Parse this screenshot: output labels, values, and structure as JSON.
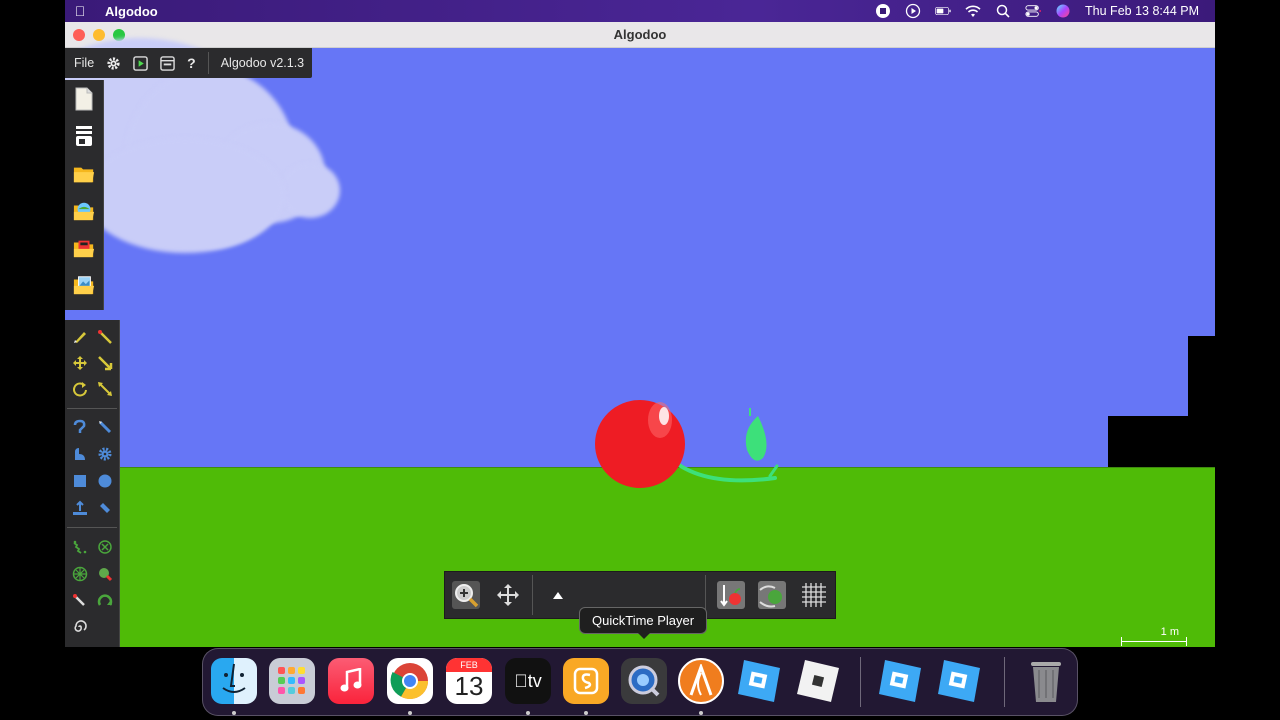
{
  "menubar": {
    "app_name": "Algodoo",
    "datetime": "Thu Feb 13  8:44 PM"
  },
  "window": {
    "title": "Algodoo"
  },
  "top_toolbar": {
    "file_label": "File",
    "version_label": "Algodoo v2.1.3"
  },
  "tooltip": {
    "text": "QuickTime Player"
  },
  "scale_bar": {
    "label": "1 m"
  },
  "dock": {
    "calendar_month": "FEB",
    "calendar_day": "13",
    "tv_label": "tv"
  },
  "colors": {
    "sky": "#6676f6",
    "ground": "#4fbb07",
    "cherry": "#ee1c24",
    "stem": "#3de07a"
  }
}
